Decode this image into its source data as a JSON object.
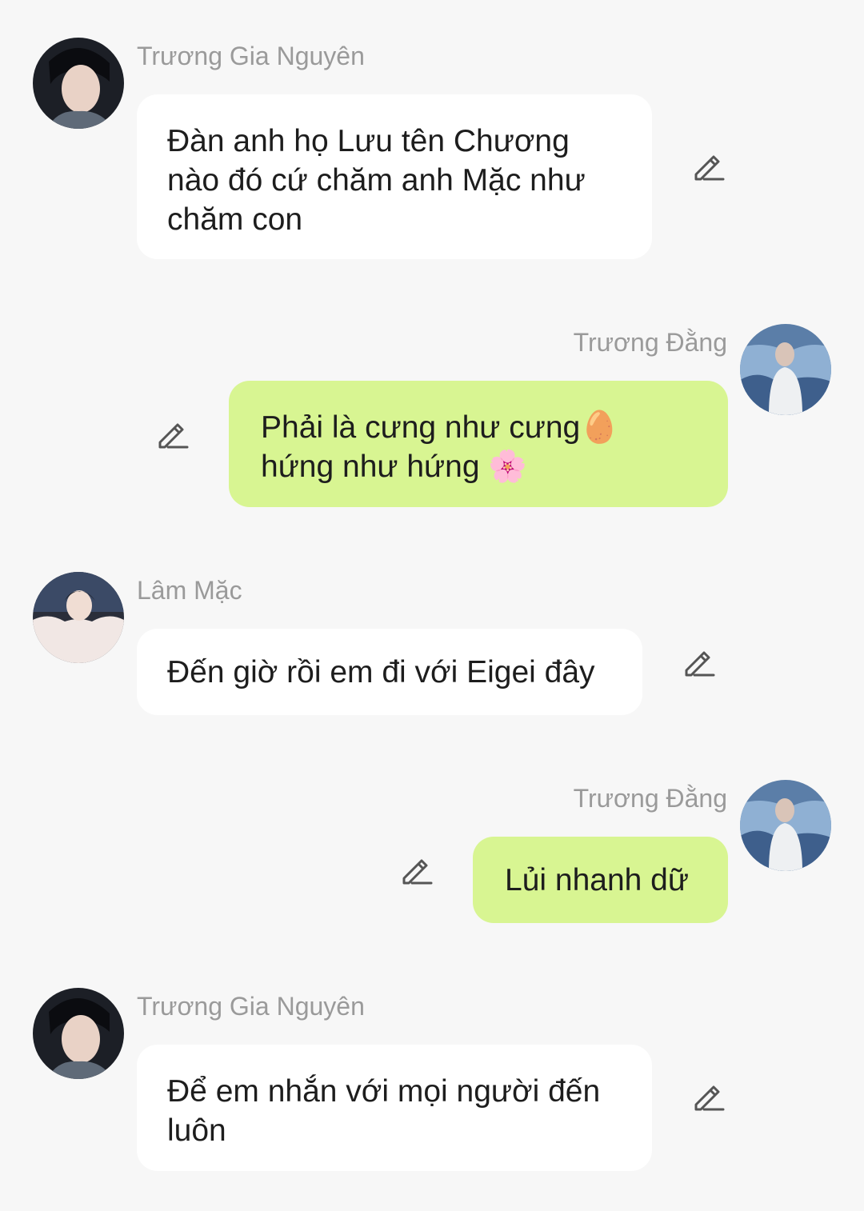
{
  "messages": [
    {
      "sender": "Trương Gia Nguyên",
      "side": "left",
      "lines": [
        "Đàn anh họ Lưu tên Chương",
        "nào đó cứ chăm anh Mặc như",
        "chăm con"
      ]
    },
    {
      "sender": "Trương Đằng",
      "side": "right",
      "lines": [
        "Phải là cưng như cưng🥚",
        "hứng như hứng 🌸"
      ]
    },
    {
      "sender": "Lâm Mặc",
      "side": "left",
      "lines": [
        "Đến giờ rồi em đi với Eigei đây"
      ]
    },
    {
      "sender": "Trương Đằng",
      "side": "right",
      "lines": [
        "Lủi nhanh dữ"
      ]
    },
    {
      "sender": "Trương Gia Nguyên",
      "side": "left",
      "lines": [
        "Để em nhắn với mọi người đến",
        "luôn"
      ]
    }
  ],
  "icons": {
    "edit": "pencil-edit-icon",
    "avatar": "user-avatar"
  },
  "colors": {
    "background": "#f7f7f7",
    "incoming_bubble": "#ffffff",
    "outgoing_bubble": "#d8f592",
    "sender_name": "#9a9a9a",
    "message_text": "#1d1d1d"
  }
}
